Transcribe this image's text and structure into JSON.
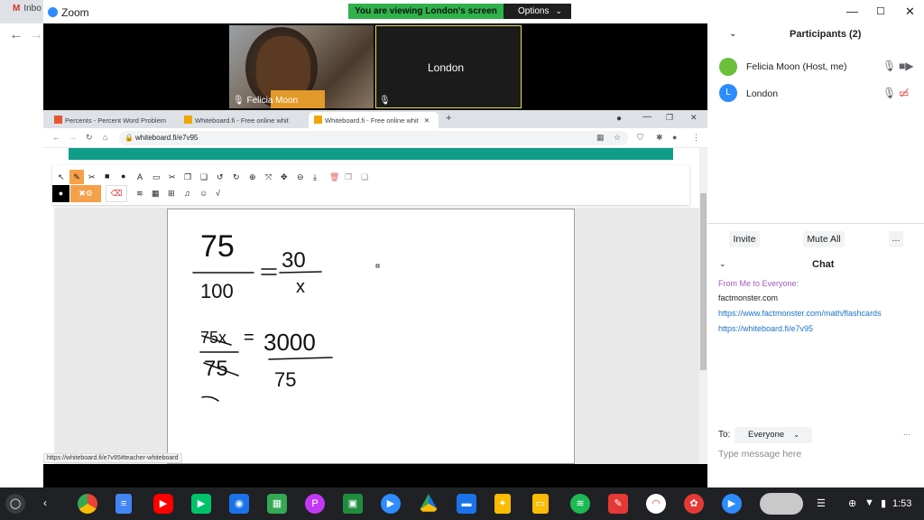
{
  "background_tab": {
    "label": "Inbo"
  },
  "zoom": {
    "app_name": "Zoom",
    "share_banner": "You are viewing London's screen",
    "options_label": "Options"
  },
  "videos": [
    {
      "name": "Felicia Moon"
    },
    {
      "name": "London"
    }
  ],
  "shared_browser": {
    "tabs": [
      {
        "label": "Percents - Percent Word Problem"
      },
      {
        "label": "Whiteboard.fi - Free online whit"
      },
      {
        "label": "Whiteboard.fi - Free online whit"
      }
    ],
    "url": "whiteboard.fi/e7v95",
    "status_url": "https://whiteboard.fi/e7v95#teacher-whiteboard",
    "handwriting": {
      "eq1": {
        "num_left": "75",
        "den_left": "100",
        "num_right": "30",
        "den_right": "x"
      },
      "eq2": {
        "left": "75x",
        "eq": "=",
        "right": "3000",
        "den_left": "75",
        "den_right": "75"
      }
    }
  },
  "participants": {
    "title": "Participants (2)",
    "list": [
      {
        "name": "Felicia Moon (Host, me)",
        "avatar_initial": "",
        "avatar_color": "#6bbf3a"
      },
      {
        "name": "London",
        "avatar_initial": "L",
        "avatar_color": "#2d8cff"
      }
    ],
    "invite_label": "Invite",
    "mute_all_label": "Mute All",
    "more_label": "..."
  },
  "chat": {
    "title": "Chat",
    "from_line": "From Me to Everyone:",
    "messages": [
      {
        "text": "factmonster.com",
        "link": false
      },
      {
        "text": "https://www.factmonster.com/math/flashcards",
        "link": true
      },
      {
        "text": "https://whiteboard.fi/e7v95",
        "link": true
      }
    ],
    "to_label": "To:",
    "recipient": "Everyone",
    "input_placeholder": "Type message here",
    "more_label": "..."
  },
  "shelf": {
    "time": "1:53",
    "apps": [
      "chrome",
      "docs",
      "youtube",
      "play-store",
      "camera",
      "sheets",
      "picsart",
      "classroom",
      "zoom",
      "drive",
      "files",
      "keep",
      "slides",
      "spotify",
      "red-app",
      "rainbow-app",
      "palette-app",
      "zoom"
    ]
  },
  "colors": {
    "zoom_blue": "#2d8cff",
    "banner_green": "#2fb24a",
    "wb_teal": "#0f9d8a",
    "active_speaker": "#e8e34d",
    "link": "#1a73c8"
  }
}
